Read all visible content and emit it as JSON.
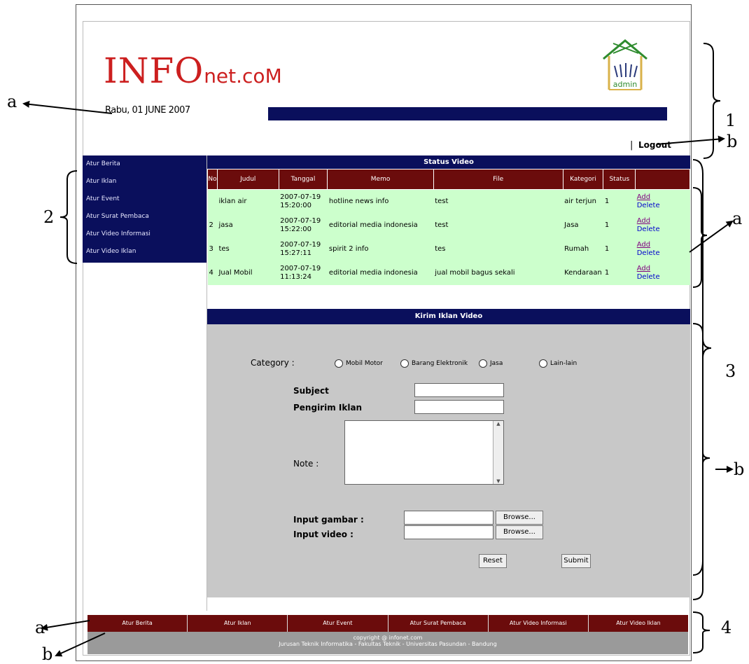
{
  "header": {
    "logo_main": "INFO",
    "logo_suffix": "net.coM",
    "date": "Rabu, 01 JUNE 2007",
    "admin_label": "admin",
    "logout_sep": "|",
    "logout": "Logout"
  },
  "sidebar": {
    "items": [
      {
        "label": "Atur Berita"
      },
      {
        "label": "Atur Iklan"
      },
      {
        "label": "Atur Event"
      },
      {
        "label": "Atur Surat Pembaca"
      },
      {
        "label": "Atur Video Informasi"
      },
      {
        "label": "Atur Video Iklan"
      }
    ]
  },
  "status": {
    "title": "Status Video",
    "columns": [
      "No",
      "Judul",
      "Tanggal",
      "Memo",
      "File",
      "Kategori",
      "Status",
      ""
    ],
    "rows": [
      {
        "no": "",
        "judul": "iklan air",
        "tanggal": "2007-07-19 15:20:00",
        "memo": "hotline news info",
        "file": "test",
        "kategori": "air terjun",
        "status": "1",
        "add": "Add",
        "delete": "Delete"
      },
      {
        "no": "2",
        "judul": "jasa",
        "tanggal": "2007-07-19 15:22:00",
        "memo": "editorial media indonesia",
        "file": "test",
        "kategori": "Jasa",
        "status": "1",
        "add": "Add",
        "delete": "Delete"
      },
      {
        "no": "3",
        "judul": "tes",
        "tanggal": "2007-07-19 15:27:11",
        "memo": "spirit 2 info",
        "file": "tes",
        "kategori": "Rumah",
        "status": "1",
        "add": "Add",
        "delete": "Delete"
      },
      {
        "no": "4",
        "judul": "Jual Mobil",
        "tanggal": "2007-07-19 11:13:24",
        "memo": "editorial media indonesia",
        "file": "jual mobil bagus sekali",
        "kategori": "Kendaraan",
        "status": "1",
        "add": "Add",
        "delete": "Delete"
      }
    ]
  },
  "kirim": {
    "title": "Kirim Iklan Video",
    "category_label": "Category :",
    "category_options": [
      "Mobil Motor",
      "Barang Elektronik",
      "Jasa",
      "Lain-lain"
    ],
    "subject_label": "Subject",
    "pengirim_label": "Pengirim Iklan",
    "note_label": "Note :",
    "gambar_label": "Input gambar :",
    "video_label": "Input video :",
    "browse1": "Browse...",
    "browse2": "Browse...",
    "reset": "Reset",
    "submit": "Submit"
  },
  "footer": {
    "nav": [
      "Atur Berita",
      "Atur Iklan",
      "Atur Event",
      "Atur Surat Pembaca",
      "Atur Video Informasi",
      "Atur Video Iklan"
    ],
    "copy_line1": "copyright @ infonet.com",
    "copy_line2": "Jurusan Teknik Informatika - Fakultas Teknik - Universitas Pasundan - Bandung"
  },
  "annotations": {
    "a1": "a",
    "one": "1",
    "b1": "b",
    "two": "2",
    "a2": "a",
    "three": "3",
    "b2": "b",
    "a3": "a",
    "four": "4",
    "b3": "b"
  },
  "colors": {
    "navy": "#0a0f5c",
    "maroon": "#6b0c0c",
    "row_green": "#ccffcc",
    "form_gray": "#c8c8c8",
    "logo_red": "#cc1f1f"
  }
}
